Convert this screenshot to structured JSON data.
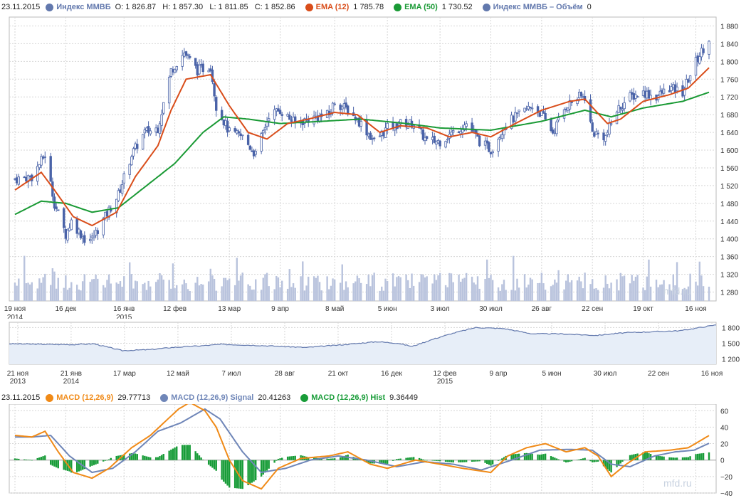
{
  "colors": {
    "candle": "#4a63a8",
    "ema12": "#d94d1a",
    "ema50": "#1a9a35",
    "volume": "#b9c3dd",
    "overview_line": "#6278ad",
    "overview_fill": "#e7eef8",
    "macd": "#f08a17",
    "signal": "#6f86b8",
    "hist": "#189c38",
    "grid": "#d6d6d6"
  },
  "top_legend": {
    "date": "23.11.2015",
    "series": [
      {
        "name": "Индекс ММВБ",
        "values": "O: 1 826.87   H: 1 857.30   L: 1 811.85   C: 1 852.86",
        "color": "#6278ad"
      },
      {
        "name": "EMA (12)",
        "values": "1 785.78",
        "color": "#d94d1a"
      },
      {
        "name": "EMA (50)",
        "values": "1 730.52",
        "color": "#1a9a35"
      },
      {
        "name": "Индекс ММВБ – Объём",
        "values": "0",
        "color": "#6278ad"
      }
    ]
  },
  "macd_legend": {
    "date": "23.11.2015",
    "series": [
      {
        "name": "MACD (12,26,9)",
        "values": "29.77713",
        "color": "#f08a17"
      },
      {
        "name": "MACD (12,26,9) Signal",
        "values": "20.41263",
        "color": "#6f86b8"
      },
      {
        "name": "MACD (12,26,9) Hist",
        "values": "9.36449",
        "color": "#189c38"
      }
    ]
  },
  "watermark": "mfd.ru",
  "chart_data": [
    {
      "type": "candlestick",
      "x_ticks": [
        {
          "date": "2014-11-19",
          "label": "19 ноя",
          "sub": "2014"
        },
        {
          "date": "2014-12-16",
          "label": "16 дек"
        },
        {
          "date": "2015-01-16",
          "label": "16 янв",
          "sub": "2015"
        },
        {
          "date": "2015-02-12",
          "label": "12 фев"
        },
        {
          "date": "2015-03-13",
          "label": "13 мар"
        },
        {
          "date": "2015-04-09",
          "label": "9 апр"
        },
        {
          "date": "2015-05-08",
          "label": "8 май"
        },
        {
          "date": "2015-06-05",
          "label": "5 июн"
        },
        {
          "date": "2015-07-03",
          "label": "3 июл"
        },
        {
          "date": "2015-07-30",
          "label": "30 июл"
        },
        {
          "date": "2015-08-26",
          "label": "26 авг"
        },
        {
          "date": "2015-09-22",
          "label": "22 сен"
        },
        {
          "date": "2015-10-19",
          "label": "19 окт"
        },
        {
          "date": "2015-11-16",
          "label": "16 ноя"
        }
      ],
      "y_ticks": [
        1280,
        1320,
        1360,
        1400,
        1440,
        1480,
        1520,
        1560,
        1600,
        1640,
        1680,
        1720,
        1760,
        1800,
        1840,
        1880
      ],
      "y_tick_labels": [
        "1 280",
        "1 320",
        "1 360",
        "1 400",
        "1 440",
        "1 480",
        "1 520",
        "1 560",
        "1 600",
        "1 640",
        "1 680",
        "1 720",
        "1 760",
        "1 800",
        "1 840",
        "1 880"
      ],
      "ylim": [
        1260,
        1900
      ],
      "x_range": [
        "2014-11-19",
        "2015-11-23"
      ],
      "grid": true,
      "close_key_points": [
        [
          "2014-11-19",
          1535
        ],
        [
          "2014-11-28",
          1540
        ],
        [
          "2014-12-05",
          1590
        ],
        [
          "2014-12-10",
          1480
        ],
        [
          "2014-12-16",
          1410
        ],
        [
          "2014-12-19",
          1440
        ],
        [
          "2014-12-26",
          1400
        ],
        [
          "2014-12-30",
          1400
        ],
        [
          "2015-01-13",
          1500
        ],
        [
          "2015-01-20",
          1590
        ],
        [
          "2015-01-27",
          1640
        ],
        [
          "2015-02-03",
          1650
        ],
        [
          "2015-02-10",
          1780
        ],
        [
          "2015-02-17",
          1820
        ],
        [
          "2015-02-24",
          1780
        ],
        [
          "2015-03-03",
          1790
        ],
        [
          "2015-03-06",
          1700
        ],
        [
          "2015-03-13",
          1640
        ],
        [
          "2015-03-20",
          1630
        ],
        [
          "2015-03-27",
          1590
        ],
        [
          "2015-04-03",
          1680
        ],
        [
          "2015-04-09",
          1690
        ],
        [
          "2015-04-17",
          1660
        ],
        [
          "2015-04-24",
          1670
        ],
        [
          "2015-05-05",
          1680
        ],
        [
          "2015-05-08",
          1710
        ],
        [
          "2015-05-15",
          1690
        ],
        [
          "2015-05-22",
          1660
        ],
        [
          "2015-05-29",
          1620
        ],
        [
          "2015-06-05",
          1650
        ],
        [
          "2015-06-12",
          1660
        ],
        [
          "2015-06-19",
          1660
        ],
        [
          "2015-06-26",
          1620
        ],
        [
          "2015-07-03",
          1620
        ],
        [
          "2015-07-10",
          1640
        ],
        [
          "2015-07-17",
          1660
        ],
        [
          "2015-07-24",
          1620
        ],
        [
          "2015-07-30",
          1600
        ],
        [
          "2015-08-07",
          1660
        ],
        [
          "2015-08-14",
          1680
        ],
        [
          "2015-08-21",
          1700
        ],
        [
          "2015-08-26",
          1680
        ],
        [
          "2015-09-01",
          1640
        ],
        [
          "2015-09-08",
          1700
        ],
        [
          "2015-09-15",
          1720
        ],
        [
          "2015-09-18",
          1720
        ],
        [
          "2015-09-22",
          1640
        ],
        [
          "2015-09-29",
          1630
        ],
        [
          "2015-10-05",
          1690
        ],
        [
          "2015-10-12",
          1720
        ],
        [
          "2015-10-19",
          1730
        ],
        [
          "2015-10-26",
          1720
        ],
        [
          "2015-11-02",
          1740
        ],
        [
          "2015-11-09",
          1730
        ],
        [
          "2015-11-16",
          1800
        ],
        [
          "2015-11-23",
          1852.86
        ]
      ],
      "series": [
        {
          "name": "EMA (12)",
          "key_points": [
            [
              "2014-11-19",
              1510
            ],
            [
              "2014-12-03",
              1550
            ],
            [
              "2014-12-10",
              1510
            ],
            [
              "2014-12-20",
              1450
            ],
            [
              "2014-12-30",
              1430
            ],
            [
              "2015-01-12",
              1460
            ],
            [
              "2015-01-22",
              1540
            ],
            [
              "2015-02-03",
              1610
            ],
            [
              "2015-02-10",
              1690
            ],
            [
              "2015-02-18",
              1760
            ],
            [
              "2015-03-03",
              1770
            ],
            [
              "2015-03-13",
              1700
            ],
            [
              "2015-03-23",
              1640
            ],
            [
              "2015-04-02",
              1625
            ],
            [
              "2015-04-13",
              1660
            ],
            [
              "2015-04-24",
              1670
            ],
            [
              "2015-05-08",
              1685
            ],
            [
              "2015-05-20",
              1680
            ],
            [
              "2015-06-01",
              1640
            ],
            [
              "2015-06-12",
              1655
            ],
            [
              "2015-06-26",
              1650
            ],
            [
              "2015-07-08",
              1630
            ],
            [
              "2015-07-20",
              1640
            ],
            [
              "2015-07-30",
              1630
            ],
            [
              "2015-08-12",
              1660
            ],
            [
              "2015-08-26",
              1690
            ],
            [
              "2015-09-10",
              1710
            ],
            [
              "2015-09-18",
              1715
            ],
            [
              "2015-09-30",
              1660
            ],
            [
              "2015-10-07",
              1670
            ],
            [
              "2015-10-19",
              1710
            ],
            [
              "2015-11-02",
              1725
            ],
            [
              "2015-11-12",
              1740
            ],
            [
              "2015-11-23",
              1785.78
            ]
          ]
        },
        {
          "name": "EMA (50)",
          "key_points": [
            [
              "2014-11-19",
              1455
            ],
            [
              "2014-12-03",
              1485
            ],
            [
              "2014-12-16",
              1480
            ],
            [
              "2014-12-30",
              1460
            ],
            [
              "2015-01-13",
              1470
            ],
            [
              "2015-01-28",
              1520
            ],
            [
              "2015-02-12",
              1570
            ],
            [
              "2015-02-27",
              1640
            ],
            [
              "2015-03-10",
              1675
            ],
            [
              "2015-03-23",
              1670
            ],
            [
              "2015-04-09",
              1660
            ],
            [
              "2015-05-01",
              1665
            ],
            [
              "2015-05-22",
              1670
            ],
            [
              "2015-06-15",
              1660
            ],
            [
              "2015-07-03",
              1650
            ],
            [
              "2015-07-30",
              1645
            ],
            [
              "2015-08-26",
              1665
            ],
            [
              "2015-09-18",
              1690
            ],
            [
              "2015-10-02",
              1675
            ],
            [
              "2015-10-19",
              1695
            ],
            [
              "2015-11-09",
              1710
            ],
            [
              "2015-11-23",
              1730.52
            ]
          ]
        },
        {
          "name": "Индекс ММВБ – Объём",
          "type": "bar",
          "profile": "light bars along the bottom of the price panel, a few spikes near 16 дек and 12 фев"
        }
      ]
    },
    {
      "type": "area",
      "x_ticks": [
        "21 ноя|2013",
        "21 янв|2014",
        "17 мар",
        "12 май",
        "7 июл",
        "28 авг",
        "21 окт",
        "16 дек",
        "12 фев|2015",
        "9 апр",
        "5 июн",
        "30 июл",
        "22 сен",
        "16 ноя"
      ],
      "y_ticks": [
        1200,
        1500,
        1800
      ],
      "y_tick_labels": [
        "1 200",
        "1 500",
        "1 800"
      ],
      "ylim": [
        1100,
        1900
      ],
      "key_points": [
        [
          0,
          1490
        ],
        [
          0.05,
          1480
        ],
        [
          0.09,
          1475
        ],
        [
          0.12,
          1490
        ],
        [
          0.135,
          1440
        ],
        [
          0.16,
          1360
        ],
        [
          0.2,
          1380
        ],
        [
          0.23,
          1420
        ],
        [
          0.27,
          1450
        ],
        [
          0.3,
          1480
        ],
        [
          0.35,
          1460
        ],
        [
          0.42,
          1420
        ],
        [
          0.47,
          1470
        ],
        [
          0.52,
          1530
        ],
        [
          0.55,
          1500
        ],
        [
          0.57,
          1440
        ],
        [
          0.6,
          1580
        ],
        [
          0.63,
          1700
        ],
        [
          0.66,
          1800
        ],
        [
          0.7,
          1780
        ],
        [
          0.74,
          1680
        ],
        [
          0.78,
          1680
        ],
        [
          0.83,
          1650
        ],
        [
          0.87,
          1700
        ],
        [
          0.91,
          1720
        ],
        [
          0.95,
          1740
        ],
        [
          1,
          1850
        ]
      ]
    },
    {
      "type": "line",
      "y_ticks": [
        -40,
        -20,
        0,
        20,
        40,
        60
      ],
      "y_tick_labels": [
        "−40",
        "−20",
        "0",
        "20",
        "40",
        "60"
      ],
      "ylim": [
        -40,
        68
      ],
      "series": [
        {
          "name": "MACD (12,26,9)",
          "key_points": [
            [
              "2014-11-19",
              30
            ],
            [
              "2014-11-28",
              28
            ],
            [
              "2014-12-05",
              35
            ],
            [
              "2014-12-12",
              10
            ],
            [
              "2014-12-20",
              -15
            ],
            [
              "2014-12-30",
              -22
            ],
            [
              "2015-01-08",
              -10
            ],
            [
              "2015-01-20",
              15
            ],
            [
              "2015-01-30",
              30
            ],
            [
              "2015-02-06",
              45
            ],
            [
              "2015-02-14",
              62
            ],
            [
              "2015-02-20",
              70
            ],
            [
              "2015-02-28",
              60
            ],
            [
              "2015-03-06",
              40
            ],
            [
              "2015-03-13",
              0
            ],
            [
              "2015-03-20",
              -25
            ],
            [
              "2015-03-30",
              -35
            ],
            [
              "2015-04-08",
              -10
            ],
            [
              "2015-04-20",
              2
            ],
            [
              "2015-05-05",
              5
            ],
            [
              "2015-05-15",
              10
            ],
            [
              "2015-05-27",
              -5
            ],
            [
              "2015-06-05",
              -10
            ],
            [
              "2015-06-20",
              0
            ],
            [
              "2015-07-03",
              -5
            ],
            [
              "2015-07-15",
              -10
            ],
            [
              "2015-07-30",
              -15
            ],
            [
              "2015-08-08",
              5
            ],
            [
              "2015-08-18",
              15
            ],
            [
              "2015-08-28",
              20
            ],
            [
              "2015-09-08",
              10
            ],
            [
              "2015-09-18",
              15
            ],
            [
              "2015-09-25",
              5
            ],
            [
              "2015-10-02",
              -20
            ],
            [
              "2015-10-10",
              -5
            ],
            [
              "2015-10-20",
              10
            ],
            [
              "2015-11-02",
              12
            ],
            [
              "2015-11-12",
              15
            ],
            [
              "2015-11-23",
              29.78
            ]
          ]
        },
        {
          "name": "MACD (12,26,9) Signal",
          "key_points": [
            [
              "2014-11-19",
              28
            ],
            [
              "2014-11-28",
              28
            ],
            [
              "2014-12-08",
              30
            ],
            [
              "2014-12-18",
              5
            ],
            [
              "2014-12-30",
              -15
            ],
            [
              "2015-01-10",
              -10
            ],
            [
              "2015-01-22",
              10
            ],
            [
              "2015-02-03",
              35
            ],
            [
              "2015-02-15",
              45
            ],
            [
              "2015-02-28",
              62
            ],
            [
              "2015-03-08",
              50
            ],
            [
              "2015-03-20",
              10
            ],
            [
              "2015-03-30",
              -15
            ],
            [
              "2015-04-12",
              -10
            ],
            [
              "2015-04-25",
              0
            ],
            [
              "2015-05-10",
              5
            ],
            [
              "2015-05-25",
              0
            ],
            [
              "2015-06-10",
              -8
            ],
            [
              "2015-06-25",
              -2
            ],
            [
              "2015-07-10",
              -5
            ],
            [
              "2015-07-25",
              -12
            ],
            [
              "2015-08-10",
              0
            ],
            [
              "2015-08-25",
              12
            ],
            [
              "2015-09-10",
              13
            ],
            [
              "2015-09-22",
              12
            ],
            [
              "2015-10-02",
              -5
            ],
            [
              "2015-10-12",
              -8
            ],
            [
              "2015-10-25",
              5
            ],
            [
              "2015-11-05",
              10
            ],
            [
              "2015-11-15",
              12
            ],
            [
              "2015-11-23",
              20.41
            ]
          ]
        },
        {
          "name": "MACD (12,26,9) Hist",
          "type": "bar",
          "profile": "derived as MACD minus Signal"
        }
      ]
    }
  ]
}
